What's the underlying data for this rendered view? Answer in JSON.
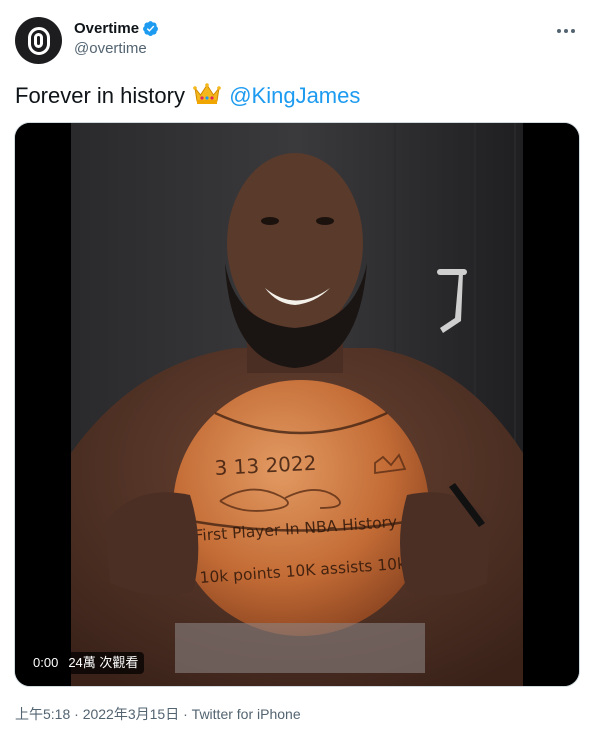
{
  "author": {
    "display_name": "Overtime",
    "handle": "@overtime"
  },
  "tweet": {
    "text": "Forever in history",
    "emoji": "crown-emoji",
    "mention": "@KingJames"
  },
  "video": {
    "time": "0:00",
    "views": "24萬 次觀看",
    "ball_text": {
      "date": "3 13 2022",
      "line1": "First Player In NBA History",
      "line2": "10k points 10K assists 10k"
    }
  },
  "meta": {
    "time": "上午5:18",
    "date": "2022年3月15日",
    "separator": "·",
    "source": "Twitter for iPhone"
  },
  "colors": {
    "link": "#1d9bf0",
    "secondary_text": "#536471",
    "primary_text": "#0f1419"
  }
}
